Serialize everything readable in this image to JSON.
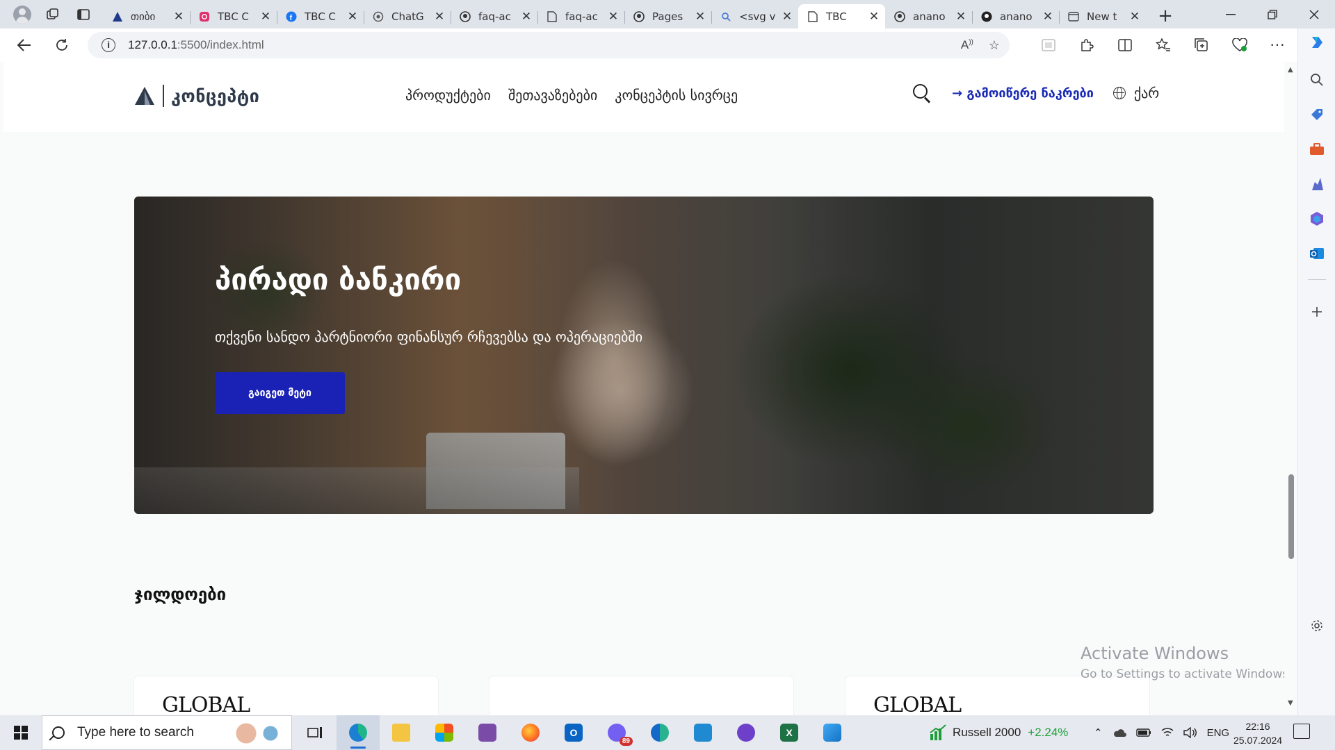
{
  "browser": {
    "tabs": [
      {
        "title": "თიბი",
        "favicon": "tbc-logo-icon",
        "active": false
      },
      {
        "title": "TBC C",
        "favicon": "instagram-icon",
        "active": false
      },
      {
        "title": "TBC C",
        "favicon": "facebook-icon",
        "active": false
      },
      {
        "title": "ChatG",
        "favicon": "chatgpt-icon",
        "active": false
      },
      {
        "title": "faq-ac",
        "favicon": "github-icon",
        "active": false
      },
      {
        "title": "faq-ac",
        "favicon": "document-icon",
        "active": false
      },
      {
        "title": "Pages",
        "favicon": "github-icon",
        "active": false
      },
      {
        "title": "<svg v",
        "favicon": "search-icon",
        "active": false
      },
      {
        "title": "TBC",
        "favicon": "document-icon",
        "active": true
      },
      {
        "title": "anano",
        "favicon": "github-icon",
        "active": false
      },
      {
        "title": "anano",
        "favicon": "github-icon",
        "active": false
      },
      {
        "title": "New t",
        "favicon": "new-tab-icon",
        "active": false
      }
    ],
    "url_host": "127.0.0.1",
    "url_rest": ":5500/index.html"
  },
  "site": {
    "logo_text": "კონცეპტი",
    "nav": [
      "პროდუქტები",
      "შეთავაზებები",
      "კონცეპტის სივრცე"
    ],
    "cta": "→ გამოიწერე ნაკრები",
    "lang": "ქარ",
    "hero": {
      "title": "პირადი ბანკირი",
      "subtitle": "თქვენი სანდო პარტნიორი ფინანსურ რჩევებსა და ოპერაციებში",
      "button": "გაიგეთ მეტი"
    },
    "awards_title": "ჯილდოები",
    "award_logos": [
      "GLOBAL",
      "",
      "GLOBAL"
    ]
  },
  "watermark": {
    "line1": "Activate Windows",
    "line2": "Go to Settings to activate Windows."
  },
  "taskbar": {
    "search_placeholder": "Type here to search",
    "mail_badge": "89",
    "ticker_name": "Russell 2000",
    "ticker_change": "+2.24%",
    "lang": "ENG",
    "time": "22:16",
    "date": "25.07.2024"
  },
  "colors": {
    "brand_blue": "#1a22b5",
    "ticker_green": "#1f9d3a"
  }
}
